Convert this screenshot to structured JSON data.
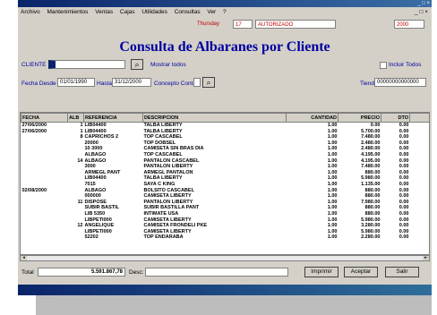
{
  "window": {
    "title": "Consulta de Albaranes por Cliente",
    "controls": "_ □ ×"
  },
  "menu": {
    "items": [
      "Archivo",
      "Mantenimientos",
      "Ventas",
      "Cajas",
      "Utilidades",
      "Consultas",
      "Ver",
      "?"
    ],
    "clock": "Thursday",
    "time_field": "17",
    "status_field": "AUTORIZADO",
    "year_field": "2000",
    "window_controls": "_ □ ×"
  },
  "form": {
    "heading": "Consulta de Albaranes por Cliente",
    "cliente_label": "CLIENTE",
    "cliente_value": "",
    "mostrar_todos": "Mostrar todos",
    "incluir_todos": "Incluir Todos",
    "fecha_desde_label": "Fecha Desde",
    "fecha_desde": "01/01/1990",
    "hasta_label": "Hasta",
    "hasta": "31/12/2000",
    "concepto_label": "Concepto Contab.",
    "concepto": "",
    "tienda_label": "Tienda",
    "tienda": "00000000000000"
  },
  "table": {
    "columns": [
      "FECHA",
      "ALB",
      "REFERENCIA",
      "DESCRIPCION",
      "CANTIDAD",
      "PRECIO",
      "DTO"
    ],
    "rows": [
      [
        "27/06/2000",
        "1",
        "LIB04400",
        "TALBA LIBERTY",
        "1.00",
        "0.00",
        "0.00"
      ],
      [
        "27/06/2000",
        "1",
        "LIB04400",
        "TALBA LIBERTY",
        "1.00",
        "5.700.00",
        "0.00"
      ],
      [
        "",
        "8",
        "CAPRICHOS 2",
        "TOP CASCABEL",
        "1.00",
        "7.480.00",
        "0.00"
      ],
      [
        "",
        "",
        "20000",
        "TOP DOBSEL",
        "1.00",
        "2.480.00",
        "0.00"
      ],
      [
        "",
        "",
        "10 3000",
        "CAMISETA SIN BRAS DIA",
        "1.00",
        "2.480.00",
        "0.00"
      ],
      [
        "",
        "",
        "ALBAGO",
        "TOP CASCABEL",
        "1.00",
        "4.195.00",
        "0.00"
      ],
      [
        "",
        "14",
        "ALBAGO",
        "PANTALON CASCABEL",
        "1.00",
        "4.195.00",
        "0.00"
      ],
      [
        "",
        "",
        "3000",
        "PANTALON LIBERTY",
        "1.00",
        "7.480.00",
        "0.00"
      ],
      [
        "",
        "",
        "ARMEGL PANT",
        "ARMEGL PANTALON",
        "1.00",
        "880.00",
        "0.00"
      ],
      [
        "",
        "",
        "LIB04400",
        "TALBA LIBERTY",
        "1.00",
        "5.980.00",
        "0.00"
      ],
      [
        "",
        "",
        "7015",
        "SAYA C KING",
        "1.00",
        "1.135.00",
        "0.00"
      ],
      [
        "02/08/2000",
        "",
        "ALBAGO",
        "BOLSITO CASCABEL",
        "1.00",
        "880.00",
        "0.00"
      ],
      [
        "",
        "",
        "000000",
        "CAMISETA LIBERTY",
        "1.00",
        "880.00",
        "0.00"
      ],
      [
        "",
        "11",
        "DISPOSE",
        "PANTALON LIBERTY",
        "1.00",
        "7.980.00",
        "0.00"
      ],
      [
        "",
        "",
        "SUBIR BASTIL",
        "SUBIR BASTILLA PANT",
        "1.00",
        "880.00",
        "0.00"
      ],
      [
        "",
        "",
        "LIB 5350",
        "INTIMATE USA",
        "1.00",
        "880.00",
        "0.00"
      ],
      [
        "",
        "",
        "LIBPETI000",
        "CAMISETA LIBERTY",
        "1.00",
        "5.980.00",
        "0.00"
      ],
      [
        "",
        "12",
        "ANGELIQUE",
        "CAMISETA FRONDELI PKE",
        "1.00",
        "3.280.00",
        "0.00"
      ],
      [
        "",
        "",
        "LIBPETI000",
        "CAMISETA LIBERTY",
        "1.00",
        "5.980.00",
        "0.00"
      ],
      [
        "",
        "",
        "52202",
        "TOP ENDARABA",
        "1.00",
        "2.280.00",
        "0.00"
      ]
    ]
  },
  "footer": {
    "total_label": "Total",
    "total_value": "5.591.867,78",
    "desc_label": "Desc:",
    "desc_value": "",
    "imprimir": "Imprimir",
    "aceptar": "Aceptar",
    "salir": "Salir"
  }
}
